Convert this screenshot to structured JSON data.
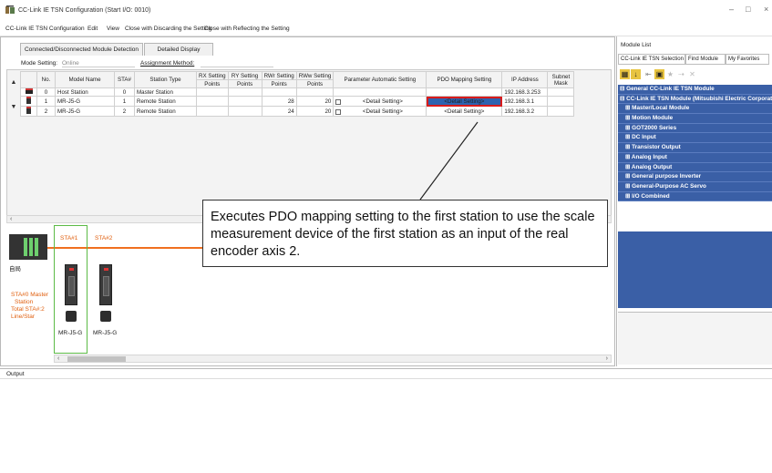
{
  "window": {
    "title": "CC-Link IE TSN Configuration (Start I/O: 0010)",
    "minimize": "–",
    "maximize": "□",
    "close": "×"
  },
  "menu": {
    "items": [
      "CC-Link IE TSN Configuration",
      "Edit",
      "View",
      "Close with Discarding the Setting",
      "Close with Reflecting the Setting"
    ]
  },
  "tabs": [
    "Connected/Disconnected Module Detection",
    "Detailed Display"
  ],
  "settings": {
    "mode_label": "Mode Setting:",
    "mode_value": "Online",
    "assignment_label": "Assignment Method:"
  },
  "grid": {
    "headers": {
      "no": "No.",
      "model_name": "Model Name",
      "sta": "STA#",
      "station_type": "Station Type",
      "rx_setting": "RX Setting",
      "ry_setting": "RY Setting",
      "rwr_setting": "RWr Setting",
      "rww_setting": "RWw Setting",
      "points": "Points",
      "param_auto": "Parameter Automatic Setting",
      "pdo_mapping": "PDO Mapping Setting",
      "ip_address": "IP Address",
      "subnet_mask": "Subnet Mask"
    },
    "rows": [
      {
        "no": "0",
        "model": "Host Station",
        "sta": "0",
        "type": "Master Station",
        "rwr": "",
        "rww": "",
        "param": "",
        "pdo": "",
        "ip": "192.168.3.253"
      },
      {
        "no": "1",
        "model": "MR-J5-G",
        "sta": "1",
        "type": "Remote Station",
        "rwr": "28",
        "rww": "20",
        "param": "<Detail Setting>",
        "pdo": "<Detail Setting>",
        "ip": "192.168.3.1"
      },
      {
        "no": "2",
        "model": "MR-J5-G",
        "sta": "2",
        "type": "Remote Station",
        "rwr": "24",
        "rww": "20",
        "param": "<Detail Setting>",
        "pdo": "<Detail Setting>",
        "ip": "192.168.3.2"
      }
    ]
  },
  "network": {
    "host_label": "自局",
    "sta1_label": "STA#1",
    "sta2_label": "STA#2",
    "device1": "MR-J5-G",
    "device2": "MR-J5-G",
    "master_info": [
      "STA#0  Master",
      "Station",
      "Total STA#:2",
      "Line/Star"
    ]
  },
  "callout": {
    "text": "Executes PDO mapping setting to the first station to use the scale measurement device of the first station as an input of the real encoder axis 2."
  },
  "module_list": {
    "title": "Module List",
    "tabs": [
      "CC-Link IE TSN Selection",
      "Find Module",
      "My Favorites"
    ],
    "items": [
      {
        "label": "⊟ General CC-Link IE TSN Module",
        "level": 0
      },
      {
        "label": "⊟ CC-Link IE TSN Module (Mitsubishi Electric Corporation)",
        "level": 0
      },
      {
        "label": "⊞ Master/Local Module",
        "level": 1
      },
      {
        "label": "⊞ Motion Module",
        "level": 1
      },
      {
        "label": "⊞ GOT2000 Series",
        "level": 1
      },
      {
        "label": "⊞ DC Input",
        "level": 1
      },
      {
        "label": "⊞ Transistor Output",
        "level": 1
      },
      {
        "label": "⊞ Analog Input",
        "level": 1
      },
      {
        "label": "⊞ Analog Output",
        "level": 1
      },
      {
        "label": "⊞ General purpose Inverter",
        "level": 1
      },
      {
        "label": "⊞ General-Purpose AC Servo",
        "level": 1
      },
      {
        "label": "⊞ I/O Combined",
        "level": 1
      }
    ]
  },
  "output": {
    "title": "Output"
  },
  "colors": {
    "accent_blue": "#3a5fa6",
    "network_line": "#f07020",
    "highlight_border": "#d81b1b",
    "sta_box": "#5cbb46"
  }
}
